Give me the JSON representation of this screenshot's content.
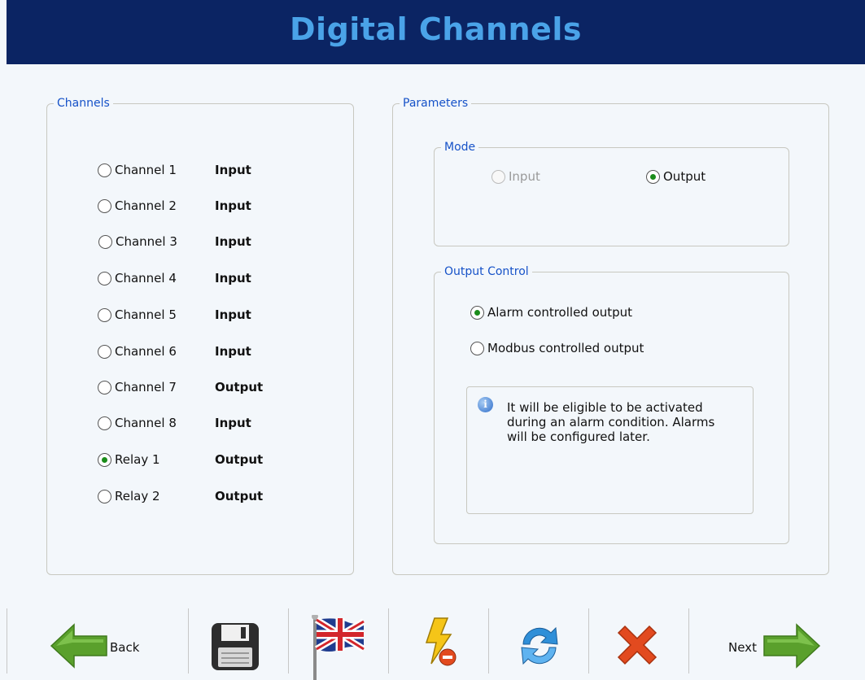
{
  "header": {
    "title": "Digital Channels"
  },
  "channels": {
    "legend": "Channels",
    "items": [
      {
        "label": "Channel 1",
        "status": "Input",
        "selected": false
      },
      {
        "label": "Channel 2",
        "status": "Input",
        "selected": false
      },
      {
        "label": "Channel 3",
        "status": "Input",
        "selected": false
      },
      {
        "label": "Channel 4",
        "status": "Input",
        "selected": false
      },
      {
        "label": "Channel 5",
        "status": "Input",
        "selected": false
      },
      {
        "label": "Channel 6",
        "status": "Input",
        "selected": false
      },
      {
        "label": "Channel 7",
        "status": "Output",
        "selected": false
      },
      {
        "label": "Channel 8",
        "status": "Input",
        "selected": false
      },
      {
        "label": "Relay 1",
        "status": "Output",
        "selected": true
      },
      {
        "label": "Relay 2",
        "status": "Output",
        "selected": false
      }
    ]
  },
  "parameters": {
    "legend": "Parameters",
    "mode": {
      "legend": "Mode",
      "input_label": "Input",
      "output_label": "Output",
      "selected": "Output",
      "input_disabled": true
    },
    "output_control": {
      "legend": "Output Control",
      "alarm_label": "Alarm controlled output",
      "modbus_label": "Modbus controlled output",
      "selected": "Alarm controlled output",
      "info_text": "It will be eligible to be activated during an alarm condition. Alarms will be configured later."
    }
  },
  "toolbar": {
    "back_label": "Back",
    "next_label": "Next",
    "icons": [
      "arrow-left-icon",
      "floppy-disk-icon",
      "uk-flag-icon",
      "lightning-icon",
      "refresh-icon",
      "red-x-icon",
      "arrow-right-icon"
    ]
  },
  "colors": {
    "header_bg": "#0b2463",
    "title": "#4aa3e8",
    "legend": "#1652c8",
    "green_arrow": "#5aa02c",
    "close_red": "#e24a1f",
    "refresh_blue": "#2f8fd8"
  }
}
